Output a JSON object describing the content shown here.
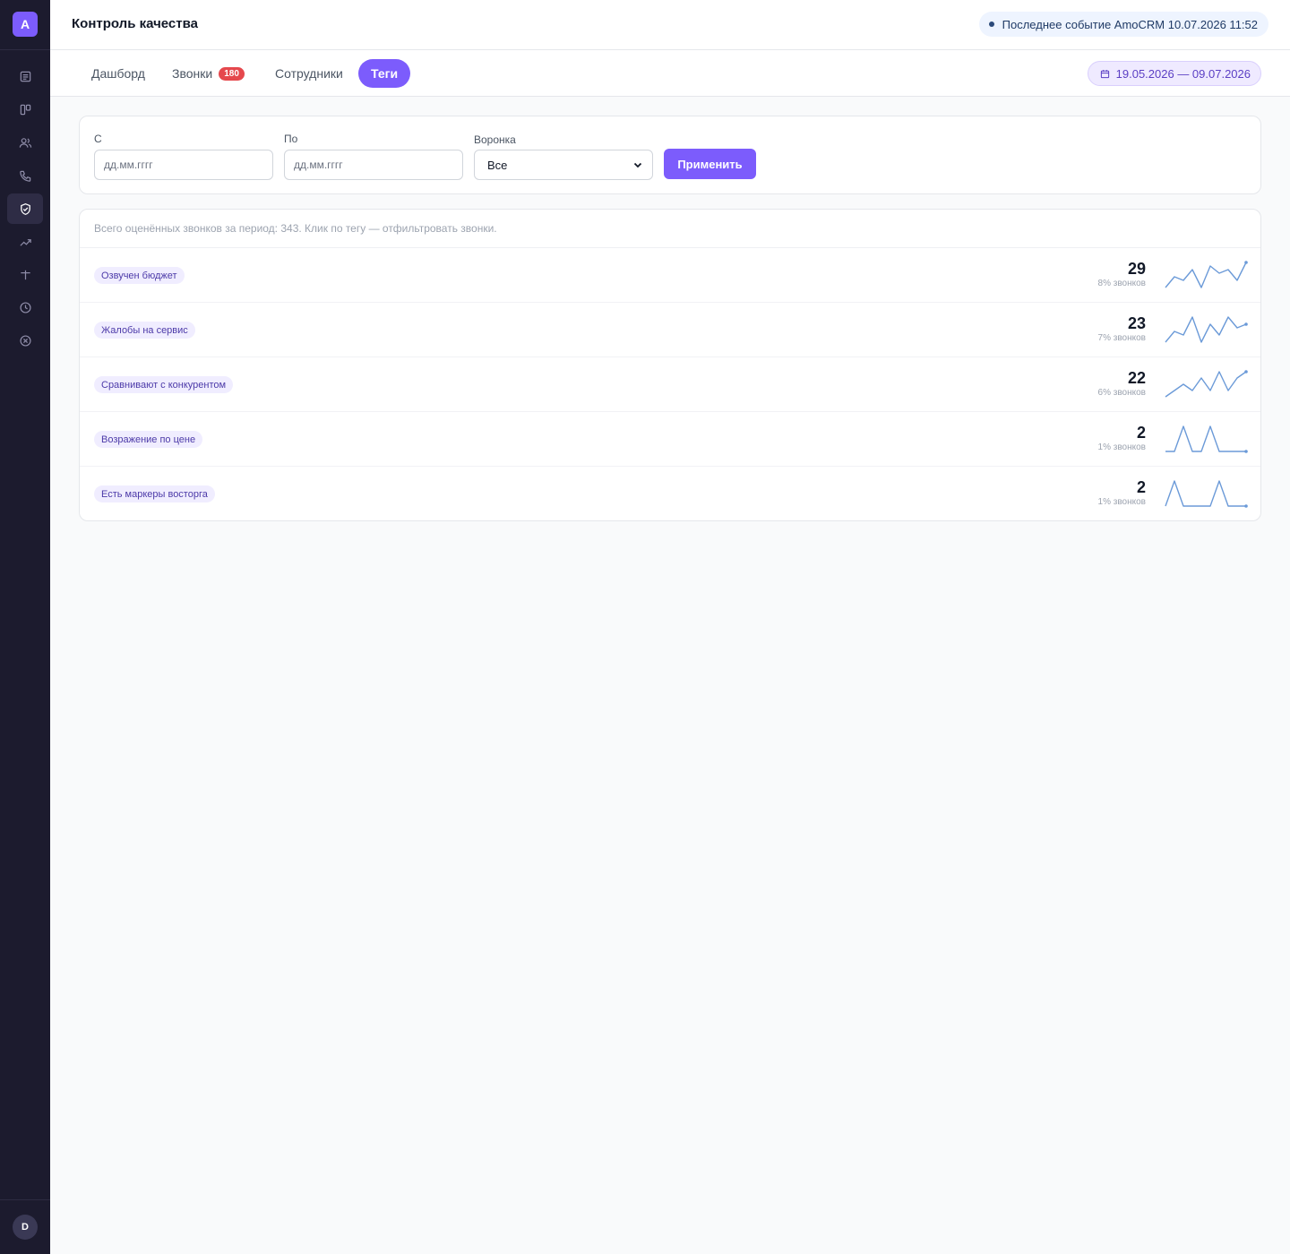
{
  "sidebar": {
    "logo": "A",
    "items": [
      {
        "icon": "document-icon",
        "active": false
      },
      {
        "icon": "kanban-icon",
        "active": false
      },
      {
        "icon": "users-icon",
        "active": false
      },
      {
        "icon": "phone-icon",
        "active": false
      },
      {
        "icon": "shield-check-icon",
        "active": true
      },
      {
        "icon": "trending-up-icon",
        "active": false
      },
      {
        "icon": "plus-icon",
        "active": false
      },
      {
        "icon": "clock-icon",
        "active": false
      },
      {
        "icon": "close-circle-icon",
        "active": false
      }
    ],
    "avatar": "D"
  },
  "header": {
    "title": "Контроль качества",
    "event": "Последнее событие AmoCRM 10.07.2026 11:52"
  },
  "tabs": [
    {
      "label": "Дашборд",
      "badge": null,
      "active": false
    },
    {
      "label": "Звонки",
      "badge": "180",
      "active": false
    },
    {
      "label": "Сотрудники",
      "badge": null,
      "active": false
    },
    {
      "label": "Теги",
      "badge": null,
      "active": true
    }
  ],
  "date_range": "19.05.2026 — 09.07.2026",
  "filters": {
    "from_label": "С",
    "from_placeholder": "дд.мм.гггг",
    "to_label": "По",
    "to_placeholder": "дд.мм.гггг",
    "funnel_label": "Воронка",
    "funnel_value": "Все",
    "apply_label": "Применить"
  },
  "summary": "Всего оценённых звонков за период: 343. Клик по тегу — отфильтровать звонки.",
  "tags": [
    {
      "name": "Озвучен бюджет",
      "count": "29",
      "pct": "8% звонков",
      "trend": [
        1,
        4,
        3,
        6,
        1,
        7,
        5,
        6,
        3,
        8
      ]
    },
    {
      "name": "Жалобы на сервис",
      "count": "23",
      "pct": "7% звонков",
      "trend": [
        1,
        4,
        3,
        8,
        1,
        6,
        3,
        8,
        5,
        6
      ]
    },
    {
      "name": "Сравнивают с конкурентом",
      "count": "22",
      "pct": "6% звонков",
      "trend": [
        1,
        2,
        3,
        2,
        4,
        2,
        5,
        2,
        4,
        5
      ]
    },
    {
      "name": "Возражение по цене",
      "count": "2",
      "pct": "1% звонков",
      "trend": [
        0,
        0,
        1,
        0,
        0,
        1,
        0,
        0,
        0,
        0
      ]
    },
    {
      "name": "Есть маркеры восторга",
      "count": "2",
      "pct": "1% звонков",
      "trend": [
        0,
        1,
        0,
        0,
        0,
        0,
        1,
        0,
        0,
        0
      ]
    }
  ],
  "colors": {
    "accent": "#7c5cfc",
    "sidebar": "#1c1b2e",
    "badge": "#e5484d",
    "sparkline": "#6b9ad8"
  }
}
